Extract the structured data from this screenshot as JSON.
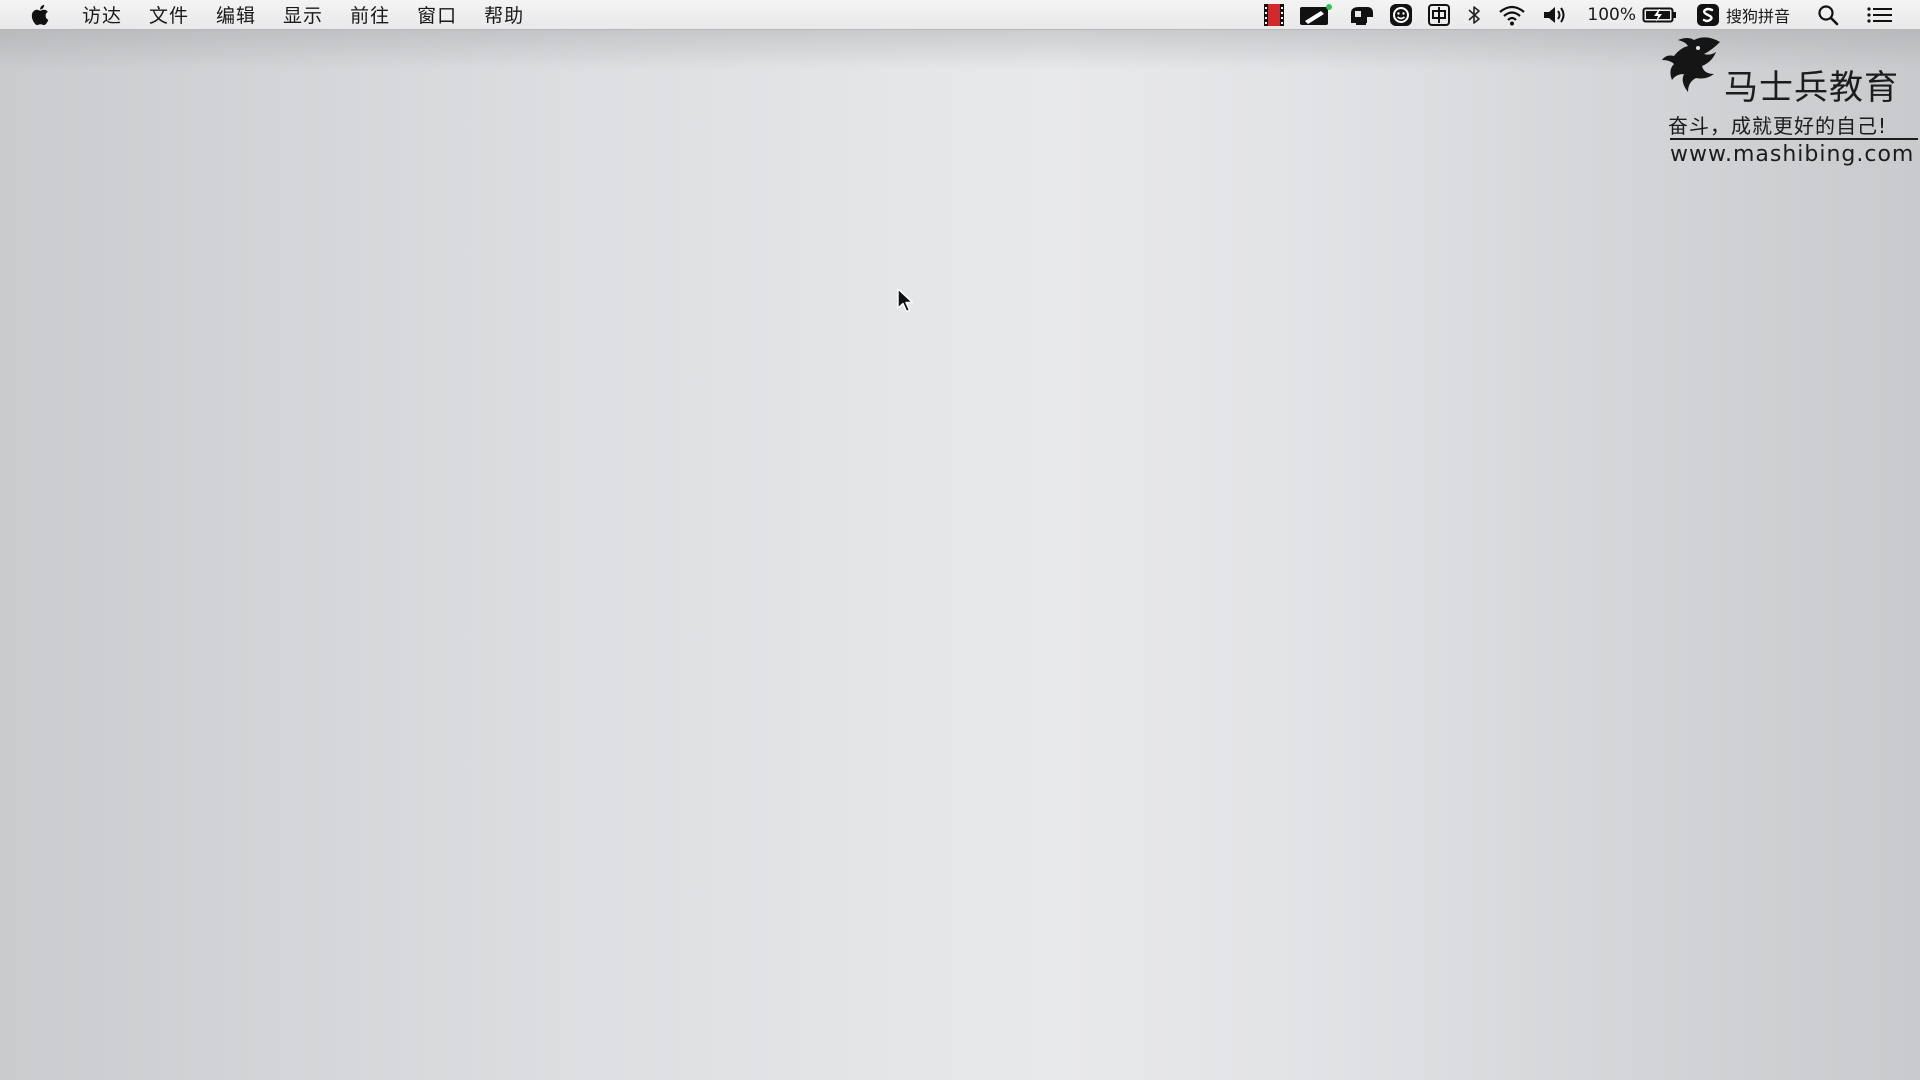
{
  "menubar": {
    "apple_icon": "apple-icon",
    "menus": [
      "访达",
      "文件",
      "编辑",
      "显示",
      "前往",
      "窗口",
      "帮助"
    ],
    "tray_icons": [
      "screen-recorder-icon",
      "pencil-note-icon",
      "cloud-sync-icon",
      "face-app-icon",
      "chinese-input-icon",
      "bluetooth-icon",
      "wifi-icon",
      "volume-icon"
    ],
    "battery_percent": "100%",
    "battery_icon": "battery-charging-icon",
    "input_method_label": "搜狗拼音",
    "spotlight_icon": "search-icon",
    "notification_icon": "list-icon"
  },
  "watermark": {
    "brand": "马士兵教育",
    "slogan": "奋斗，成就更好的自己!",
    "url": "www.mashibing.com"
  },
  "colors": {
    "menubar_bg": "#efefef",
    "desktop_mid": "#e8e9eb",
    "desktop_edge": "#c9cbce",
    "recorder_red": "#d3282c",
    "text": "#1a1a1a"
  }
}
